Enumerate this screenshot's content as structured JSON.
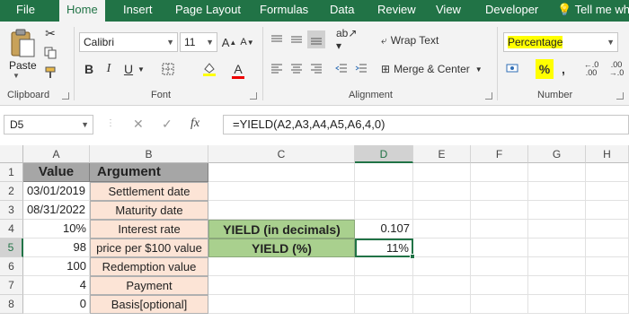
{
  "ribbon": {
    "tabs": [
      "File",
      "Home",
      "Insert",
      "Page Layout",
      "Formulas",
      "Data",
      "Review",
      "View",
      "Developer"
    ],
    "active_tab": "Home",
    "tell_me": "Tell me wha",
    "clipboard": {
      "paste_label": "Paste",
      "group_label": "Clipboard"
    },
    "font": {
      "name": "Calibri",
      "size": "11",
      "group_label": "Font"
    },
    "alignment": {
      "wrap_text": "Wrap Text",
      "merge_center": "Merge & Center",
      "group_label": "Alignment"
    },
    "number": {
      "format": "Percentage",
      "group_label": "Number"
    }
  },
  "formula_bar": {
    "name_box": "D5",
    "formula": "=YIELD(A2,A3,A4,A5,A6,4,0)"
  },
  "grid": {
    "columns": [
      "A",
      "B",
      "C",
      "D",
      "E",
      "F",
      "G",
      "H"
    ],
    "rows": [
      "1",
      "2",
      "3",
      "4",
      "5",
      "6",
      "7",
      "8"
    ],
    "cells": {
      "A1": "Value",
      "B1": "Argument",
      "A2": "03/01/2019",
      "B2": "Settlement date",
      "A3": "08/31/2022",
      "B3": "Maturity date",
      "A4": "10%",
      "B4": "Interest rate",
      "C4": "YIELD (in decimals)",
      "D4": "0.107",
      "A5": "98",
      "B5": "price per $100 value",
      "C5": "YIELD (%)",
      "D5": "11%",
      "A6": "100",
      "B6": "Redemption value",
      "A7": "4",
      "B7": "Payment",
      "A8": "0",
      "B8": "Basis[optional]"
    },
    "selected_cell": "D5"
  },
  "colors": {
    "excel_green": "#217346",
    "header_fill": "#a6a6a6",
    "argument_fill": "#fce4d6",
    "result_fill": "#a9d08e",
    "highlight": "#ffff00"
  }
}
